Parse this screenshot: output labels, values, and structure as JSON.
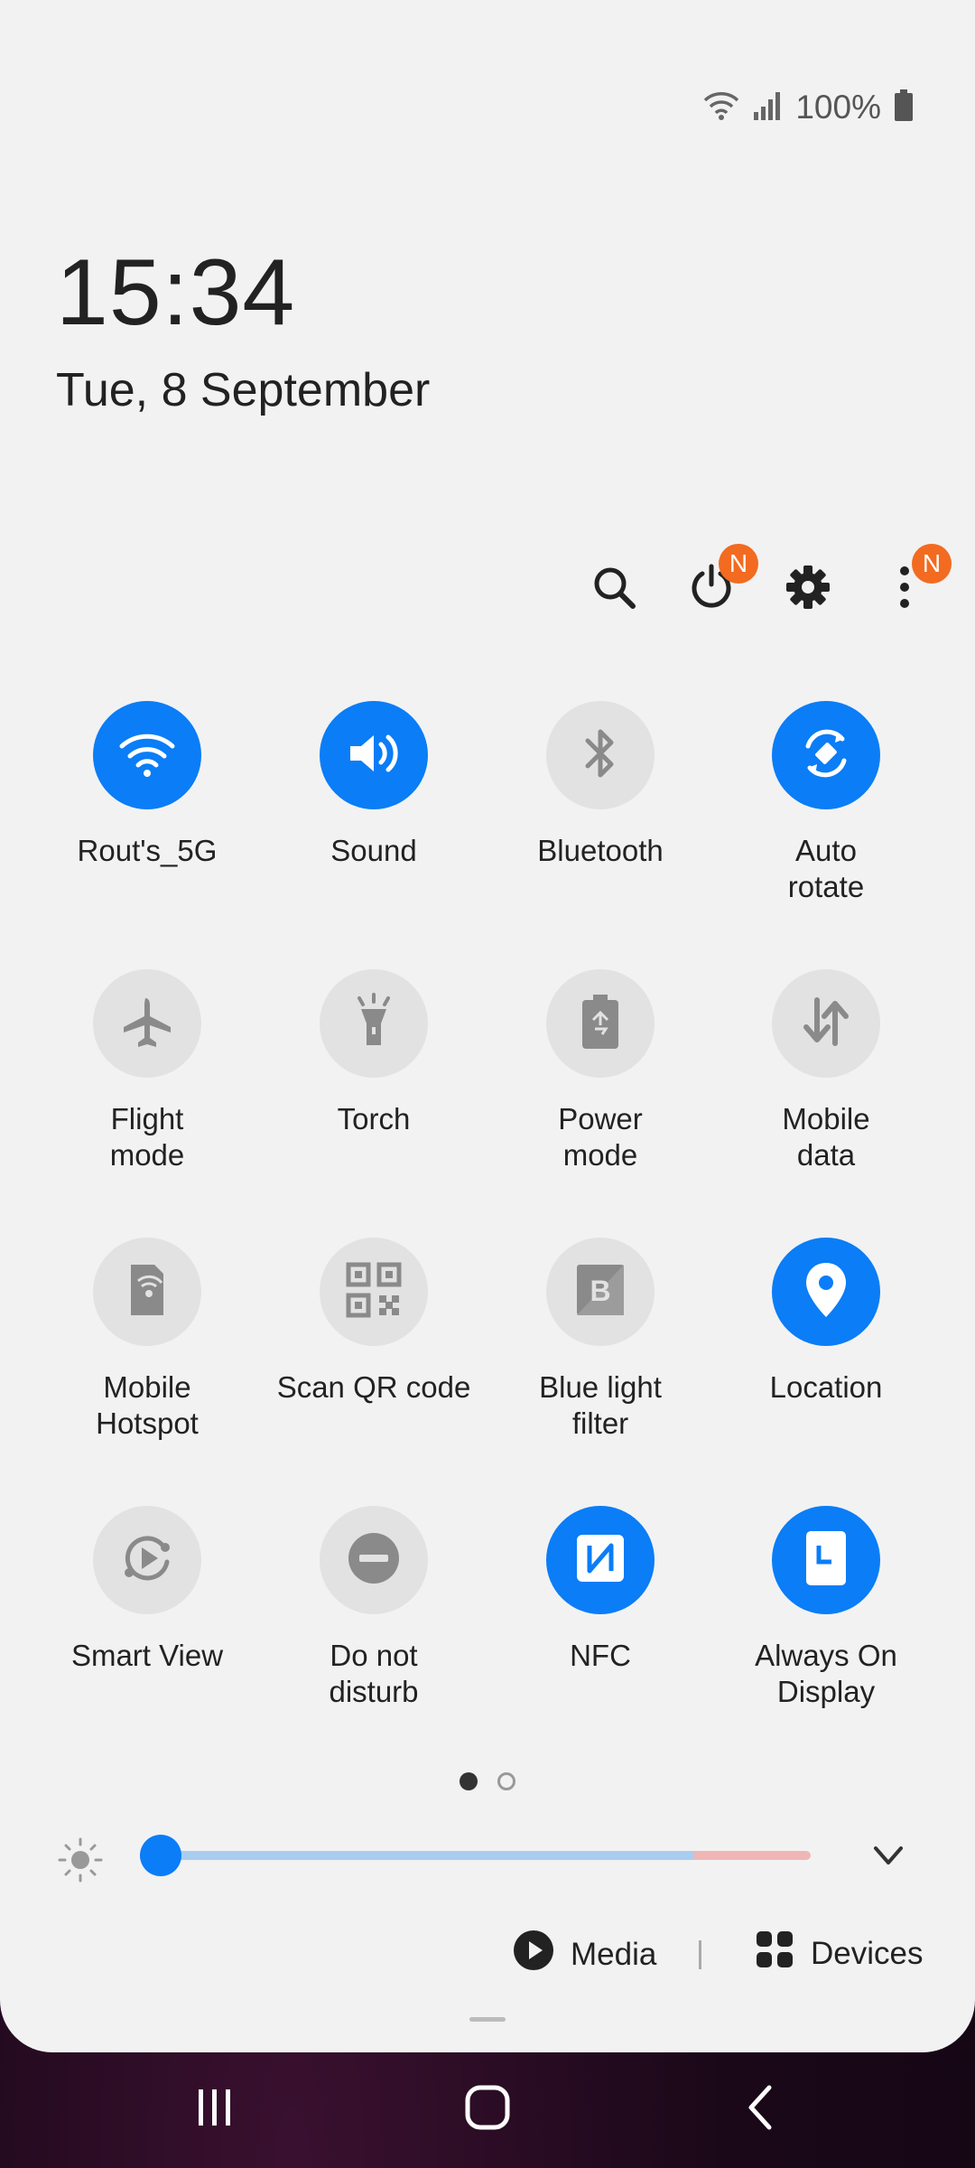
{
  "status_bar": {
    "battery_text": "100%",
    "icons": [
      "wifi-icon",
      "signal-icon",
      "battery-icon"
    ]
  },
  "clock": {
    "time": "15:34",
    "date": "Tue, 8 September"
  },
  "top_actions": {
    "icons": [
      "search-icon",
      "power-icon",
      "gear-icon",
      "more-vertical-icon"
    ],
    "badge": "N"
  },
  "tiles": [
    {
      "label": "Rout's_5G",
      "icon": "wifi-icon",
      "state": "on"
    },
    {
      "label": "Sound",
      "icon": "volume-icon",
      "state": "on"
    },
    {
      "label": "Bluetooth",
      "icon": "bluetooth-icon",
      "state": "off"
    },
    {
      "label": "Auto\nrotate",
      "icon": "auto-rotate-icon",
      "state": "on"
    },
    {
      "label": "Flight\nmode",
      "icon": "airplane-icon",
      "state": "off"
    },
    {
      "label": "Torch",
      "icon": "torch-icon",
      "state": "off"
    },
    {
      "label": "Power\nmode",
      "icon": "power-mode-icon",
      "state": "off"
    },
    {
      "label": "Mobile\ndata",
      "icon": "mobile-data-icon",
      "state": "off"
    },
    {
      "label": "Mobile\nHotspot",
      "icon": "hotspot-icon",
      "state": "off"
    },
    {
      "label": "Scan QR code",
      "icon": "qr-code-icon",
      "state": "off"
    },
    {
      "label": "Blue light\nfilter",
      "icon": "blue-light-icon",
      "state": "off"
    },
    {
      "label": "Location",
      "icon": "location-pin-icon",
      "state": "on"
    },
    {
      "label": "Smart View",
      "icon": "smart-view-icon",
      "state": "off"
    },
    {
      "label": "Do not\ndisturb",
      "icon": "do-not-disturb-icon",
      "state": "off"
    },
    {
      "label": "NFC",
      "icon": "nfc-icon",
      "state": "on"
    },
    {
      "label": "Always On\nDisplay",
      "icon": "always-on-display-icon",
      "state": "on"
    }
  ],
  "pages": {
    "count": 2,
    "current": 1
  },
  "brightness": {
    "level": 0.02
  },
  "bottom": {
    "media_label": "Media",
    "devices_label": "Devices"
  },
  "colors": {
    "accent": "#0a7df7",
    "tile_off": "#e2e2e2",
    "panel": "#f2f2f2",
    "badge": "#f26b21"
  }
}
